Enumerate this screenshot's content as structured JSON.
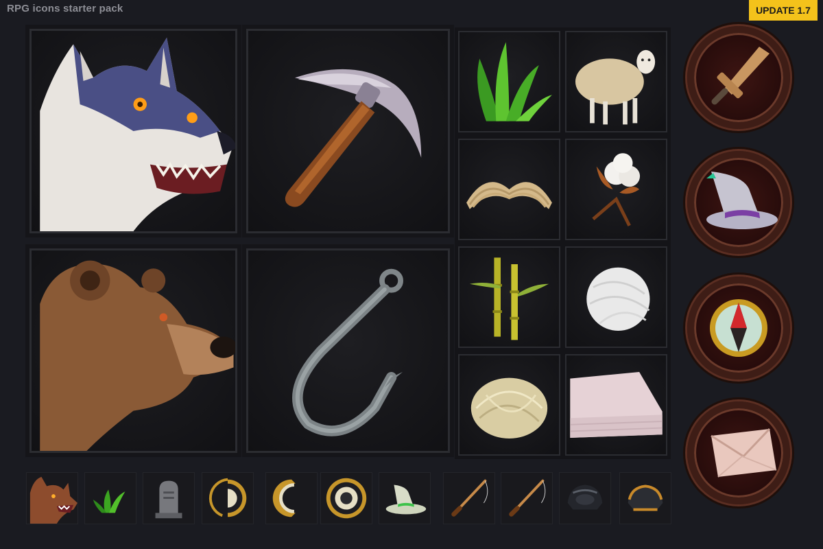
{
  "header": {
    "title": "RPG icons starter pack",
    "badge": "UPDATE 1.7"
  },
  "icons": {
    "large": [
      "wolf-icon",
      "pickaxe-icon",
      "bear-icon",
      "fishing-hook-icon"
    ],
    "small": [
      "grass-icon",
      "sheep-icon",
      "dry-grass-bundle-icon",
      "cotton-plant-icon",
      "bamboo-icon",
      "yarn-ball-icon",
      "fiber-tuft-icon",
      "cloth-icon"
    ],
    "round": [
      "wooden-sword-icon",
      "wizard-hat-icon",
      "compass-icon",
      "envelope-icon"
    ],
    "row": [
      "wolf-icon",
      "grass-icon",
      "gravestone-icon",
      "coin-half-icon",
      "coin-sliver-icon",
      "coin-icon",
      "witch-hat-icon",
      "fishing-rod-icon",
      "fishing-rod-icon",
      "dark-armor-icon",
      "gold-armor-icon"
    ]
  },
  "colors": {
    "badge": "#f4c21b",
    "background": "#1a1b21",
    "round_frame": "#3e1d16"
  }
}
